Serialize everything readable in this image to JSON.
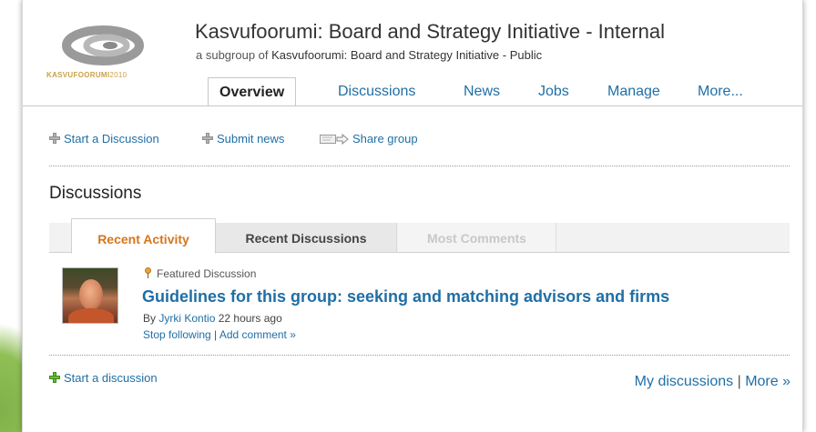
{
  "group": {
    "logo_text": "KASVUFOORUMI",
    "logo_year": "2010",
    "title": "Kasvufoorumi: Board and Strategy Initiative - Internal",
    "subgroup_prefix": "a subgroup of ",
    "parent_group": "Kasvufoorumi: Board and Strategy Initiative - Public"
  },
  "nav": {
    "tabs": [
      {
        "label": "Overview",
        "active": true
      },
      {
        "label": "Discussions"
      },
      {
        "label": "News"
      },
      {
        "label": "Jobs"
      },
      {
        "label": "Manage"
      },
      {
        "label": "More..."
      }
    ]
  },
  "actions": {
    "start_discussion": "Start a Discussion",
    "submit_news": "Submit news",
    "share_group": "Share group"
  },
  "discussions": {
    "heading": "Discussions",
    "tabs": [
      {
        "label": "Recent Activity",
        "state": "active"
      },
      {
        "label": "Recent Discussions",
        "state": "normal"
      },
      {
        "label": "Most Comments",
        "state": "disabled"
      }
    ],
    "item": {
      "badge": "Featured Discussion",
      "title": "Guidelines for this group: seeking and matching advisors and firms",
      "by_prefix": "By ",
      "author": "Jyrki Kontio",
      "time": " 22 hours ago",
      "stop_following": "Stop following",
      "separator": " | ",
      "add_comment": "Add comment »"
    },
    "start_link": "Start a discussion",
    "my_discussions": "My discussions",
    "footer_sep": " | ",
    "more": "More »"
  },
  "colors": {
    "link": "#1f6fa6",
    "active_tab": "#d7761a",
    "accent_green": "#6cbb3c"
  },
  "icons": [
    "plus-icon",
    "share-icon",
    "pin-icon",
    "green-plus-icon"
  ]
}
